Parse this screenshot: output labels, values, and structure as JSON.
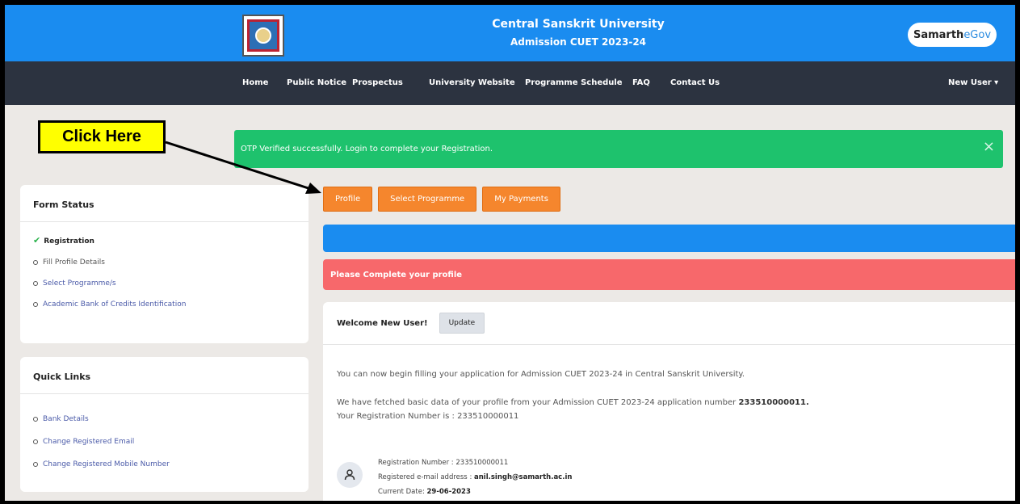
{
  "header": {
    "title": "Central Sanskrit University",
    "subtitle": "Admission CUET 2023-24",
    "brand_a": "Samarth",
    "brand_b": "eGov"
  },
  "nav": {
    "items": [
      "Home",
      "Public Notice",
      "Prospectus",
      "University Website",
      "Programme Schedule",
      "FAQ",
      "Contact Us"
    ],
    "user_menu": "New User ▾"
  },
  "callout": {
    "text": "Click Here"
  },
  "alert": {
    "message": "OTP Verified successfully. Login to complete your Registration.",
    "close": "×"
  },
  "form_status": {
    "title": "Form Status",
    "items": [
      "Registration",
      "Fill Profile Details",
      "Select Programme/s",
      "Academic Bank of Credits Identification"
    ],
    "check_glyph": "✔"
  },
  "quick_links": {
    "title": "Quick Links",
    "items": [
      "Bank Details",
      "Change Registered Email",
      "Change Registered Mobile Number"
    ]
  },
  "actions": {
    "profile": "Profile",
    "select_programme": "Select Programme",
    "my_payments": "My Payments"
  },
  "notice": {
    "incomplete": "Please Complete your profile"
  },
  "main": {
    "welcome": "Welcome New User!",
    "update": "Update",
    "line1": "You can now begin filling your application for Admission CUET 2023-24 in Central Sanskrit University.",
    "line2_prefix": "We have fetched basic data of your profile from your Admission CUET 2023-24 application number ",
    "line2_number": "233510000011.",
    "line3": "Your Registration Number is : 233510000011",
    "reg_label": "Registration Number : ",
    "reg_value": "233510000011",
    "email_label": "Registered e-mail address : ",
    "email_value": "anil.singh@samarth.ac.in",
    "date_label": "Current Date: ",
    "date_value": "29-06-2023"
  },
  "colors": {
    "header_blue": "#1a8cf0",
    "nav_dark": "#2c3340",
    "success_green": "#1ec26d",
    "orange": "#f5862d",
    "danger_red": "#f7686b",
    "callout_yellow": "#ffff00"
  },
  "icons": [
    "university-emblem-icon",
    "close-icon",
    "check-icon",
    "user-icon",
    "arrow-icon"
  ]
}
